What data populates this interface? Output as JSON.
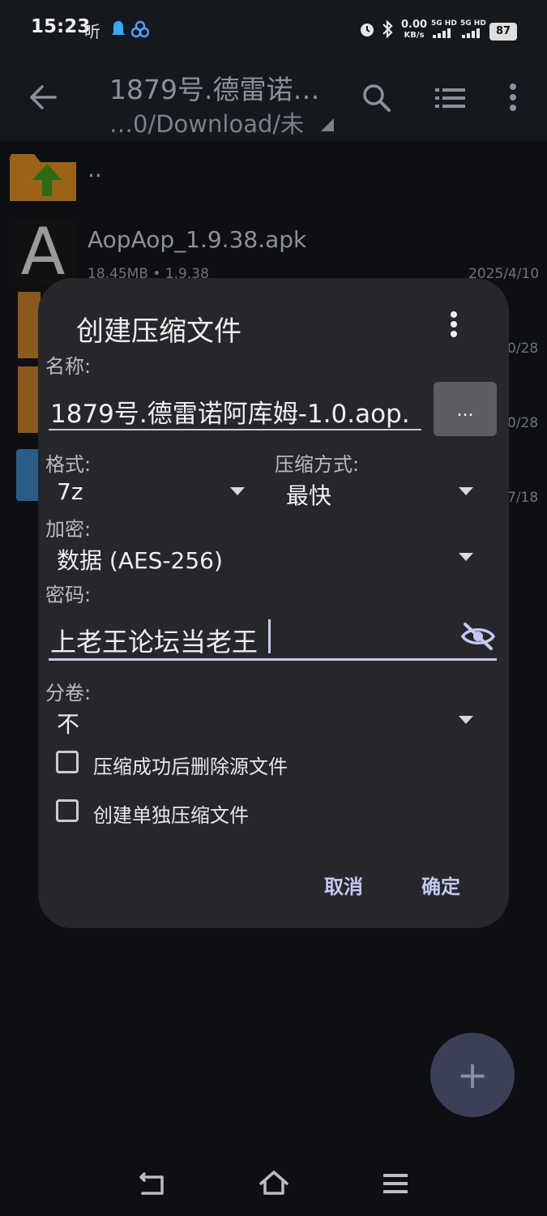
{
  "status_bar": {
    "time": "15:23",
    "ting": "听",
    "net_speed_top": "0.00",
    "net_speed_bottom": "KB/s",
    "sig1": "5G HD",
    "sig2": "5G HD",
    "battery": "87"
  },
  "app_bar": {
    "title": "1879号.德雷诺…",
    "subtitle": "…0/Download/未"
  },
  "files": [
    {
      "name": "..",
      "meta": "",
      "date": ""
    },
    {
      "name": "AopAop_1.9.38.apk",
      "meta": "18.45MB  • 1.9.38",
      "date": "2025/4/10"
    },
    {
      "name": "",
      "meta": "",
      "date": "0/28"
    },
    {
      "name": "",
      "meta": "",
      "date": "0/28"
    },
    {
      "name": "",
      "meta": "",
      "date": "7/18"
    }
  ],
  "dialog": {
    "title": "创建压缩文件",
    "name_label": "名称:",
    "name_value": "1879号.德雷诺阿库姆-1.0.aop.",
    "browse_label": "...",
    "format_label": "格式:",
    "format_value": "7z",
    "method_label": "压缩方式:",
    "method_value": "最快",
    "encrypt_label": "加密:",
    "encrypt_value": "数据 (AES-256)",
    "password_label": "密码:",
    "password_value": "上老王论坛当老王",
    "split_label": "分卷:",
    "split_value": "不",
    "delete_after_label": "压缩成功后删除源文件",
    "separate_label": "创建单独压缩文件",
    "cancel_label": "取消",
    "ok_label": "确定"
  },
  "fab": {
    "label": "+"
  },
  "colors": {
    "dialog_bg": "#26272b",
    "accent": "#c4c8f5",
    "fab_bg": "#3c4056",
    "background": "#0d0f12"
  }
}
